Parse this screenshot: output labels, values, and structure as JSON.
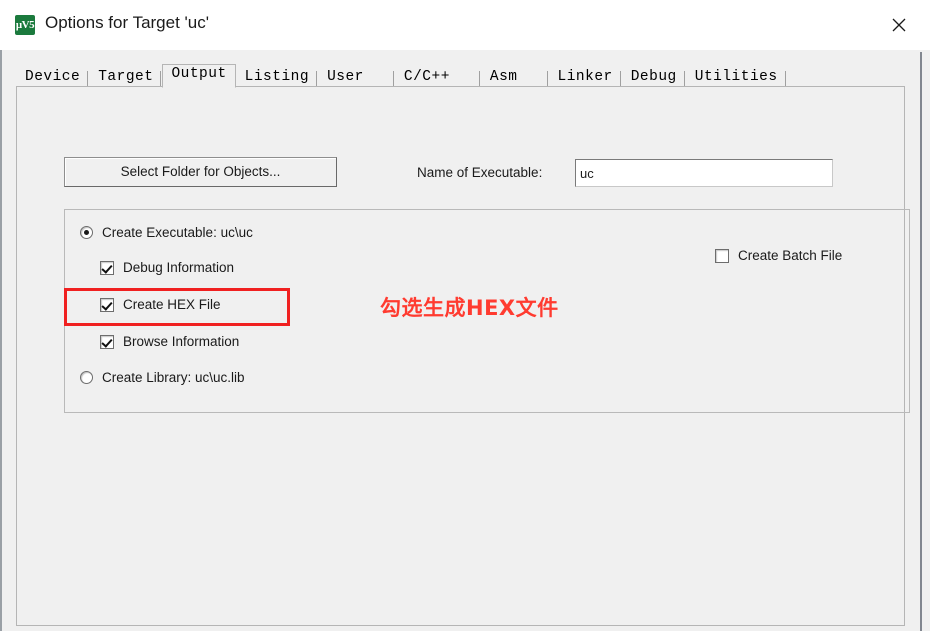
{
  "window": {
    "title": "Options for Target 'uc'",
    "app_icon_name": "keil-uvision5-icon",
    "app_icon_glyph": "μV5",
    "close_label": "✕",
    "accent_color": "#1b7a3d"
  },
  "tabs": [
    {
      "label": "Device",
      "active": false
    },
    {
      "label": "Target",
      "active": false
    },
    {
      "label": "Output",
      "active": true
    },
    {
      "label": "Listing",
      "active": false
    },
    {
      "label": "User",
      "active": false
    },
    {
      "label": "C/C++",
      "active": false
    },
    {
      "label": "Asm",
      "active": false
    },
    {
      "label": "Linker",
      "active": false
    },
    {
      "label": "Debug",
      "active": false
    },
    {
      "label": "Utilities",
      "active": false
    }
  ],
  "output": {
    "select_folder_button": "Select Folder for Objects...",
    "executable_label": "Name of Executable:",
    "executable_value": "uc",
    "executable_placeholder": "",
    "create_executable": {
      "label": "Create Executable:  uc\\uc",
      "checked": true
    },
    "debug_information": {
      "label": "Debug Information",
      "checked": true
    },
    "create_hex_file": {
      "label": "Create HEX File",
      "checked": true
    },
    "browse_information": {
      "label": "Browse Information",
      "checked": true
    },
    "create_library": {
      "label": "Create Library:  uc\\uc.lib",
      "checked": false
    },
    "create_batch_file": {
      "label": "Create Batch File",
      "checked": false
    }
  },
  "annotation": {
    "text": "勾选生成HEX文件",
    "color": "#ff3b30",
    "highlight_color": "#f02020"
  }
}
